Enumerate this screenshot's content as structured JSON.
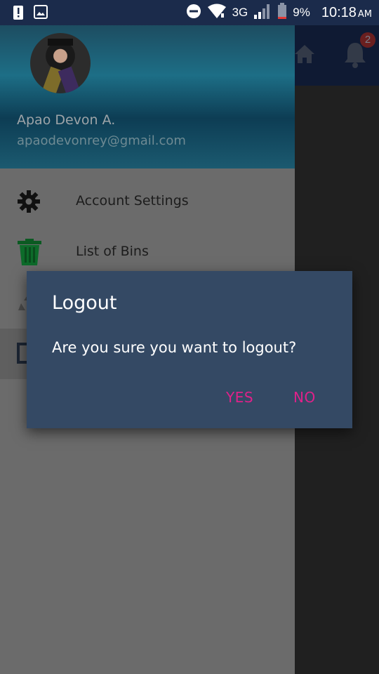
{
  "status_bar": {
    "battery": "9%",
    "network": "3G",
    "time": "10:18",
    "ampm": "AM",
    "icons": [
      "alert-icon",
      "image-icon",
      "do-not-disturb-icon",
      "wifi-icon",
      "signal-icon",
      "battery-icon"
    ]
  },
  "app_bar": {
    "notification_count": "2",
    "icons": [
      "home-icon",
      "bell-icon"
    ]
  },
  "drawer": {
    "profile": {
      "name": "Apao Devon A.",
      "email": "apaodevonrey@gmail.com"
    },
    "items": [
      {
        "label": "Account Settings",
        "icon": "gear-icon"
      },
      {
        "label": "List of Bins",
        "icon": "trash-bin-icon"
      },
      {
        "label": "",
        "icon": "recycle-icon"
      },
      {
        "label": "",
        "icon": "logout-icon"
      }
    ]
  },
  "dialog": {
    "title": "Logout",
    "message": "Are you sure you want to logout?",
    "yes_label": "YES",
    "no_label": "NO",
    "button_color": "#e0218a"
  },
  "colors": {
    "status_bar": "#1b2b4b",
    "dialog_bg": "#344964",
    "drawer_bg": "#6b6b6b"
  }
}
